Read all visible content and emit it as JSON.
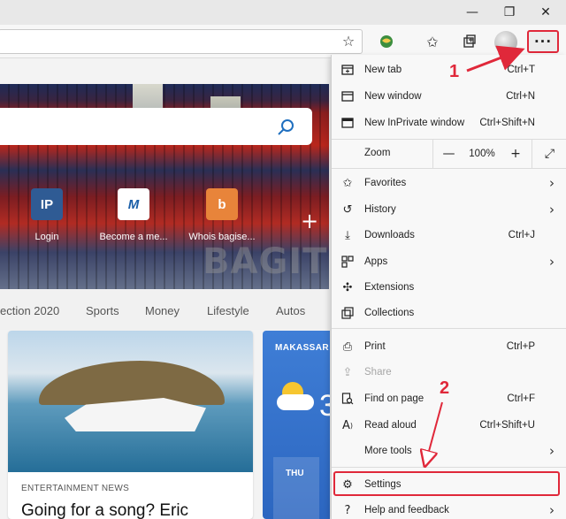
{
  "window": {
    "minimize_glyph": "—",
    "maximize_glyph": "❐",
    "close_glyph": "✕"
  },
  "toolbar": {
    "address_value": "",
    "more_label": "···"
  },
  "new_tab_page": {
    "quick_links": [
      {
        "label": "Login",
        "tile_text": "IP",
        "tile_color": "#2f5b94",
        "text_color": "#ffffff"
      },
      {
        "label": "Become a me...",
        "tile_text": "M",
        "tile_color": "#ffffff",
        "text_color": "#1b5fa8"
      },
      {
        "label": "Whois bagise...",
        "tile_text": "b",
        "tile_color": "#e8843a",
        "text_color": "#ffffff"
      }
    ],
    "categories": [
      "ection 2020",
      "Sports",
      "Money",
      "Lifestyle",
      "Autos"
    ],
    "card": {
      "kicker": "ENTERTAINMENT NEWS",
      "headline": "Going for a song? Eric"
    },
    "weather": {
      "city": "MAKASSAR",
      "temp_partial": "3",
      "day": "THU"
    },
    "watermark": "BAGITEKNO"
  },
  "menu": {
    "new_tab": {
      "label": "New tab",
      "shortcut": "Ctrl+T"
    },
    "new_window": {
      "label": "New window",
      "shortcut": "Ctrl+N"
    },
    "new_inprivate": {
      "label": "New InPrivate window",
      "shortcut": "Ctrl+Shift+N"
    },
    "zoom": {
      "label": "Zoom",
      "minus": "—",
      "value": "100%",
      "plus": "+",
      "fullscreen": "⤢"
    },
    "favorites": {
      "label": "Favorites"
    },
    "history": {
      "label": "History"
    },
    "downloads": {
      "label": "Downloads",
      "shortcut": "Ctrl+J"
    },
    "apps": {
      "label": "Apps"
    },
    "extensions": {
      "label": "Extensions"
    },
    "collections": {
      "label": "Collections"
    },
    "print": {
      "label": "Print",
      "shortcut": "Ctrl+P"
    },
    "share": {
      "label": "Share"
    },
    "find": {
      "label": "Find on page",
      "shortcut": "Ctrl+F"
    },
    "read_aloud": {
      "label": "Read aloud",
      "shortcut": "Ctrl+Shift+U"
    },
    "more_tools": {
      "label": "More tools"
    },
    "settings": {
      "label": "Settings"
    },
    "help": {
      "label": "Help and feedback"
    }
  },
  "annotations": {
    "step1": "1",
    "step2": "2",
    "color": "#e0283a"
  }
}
